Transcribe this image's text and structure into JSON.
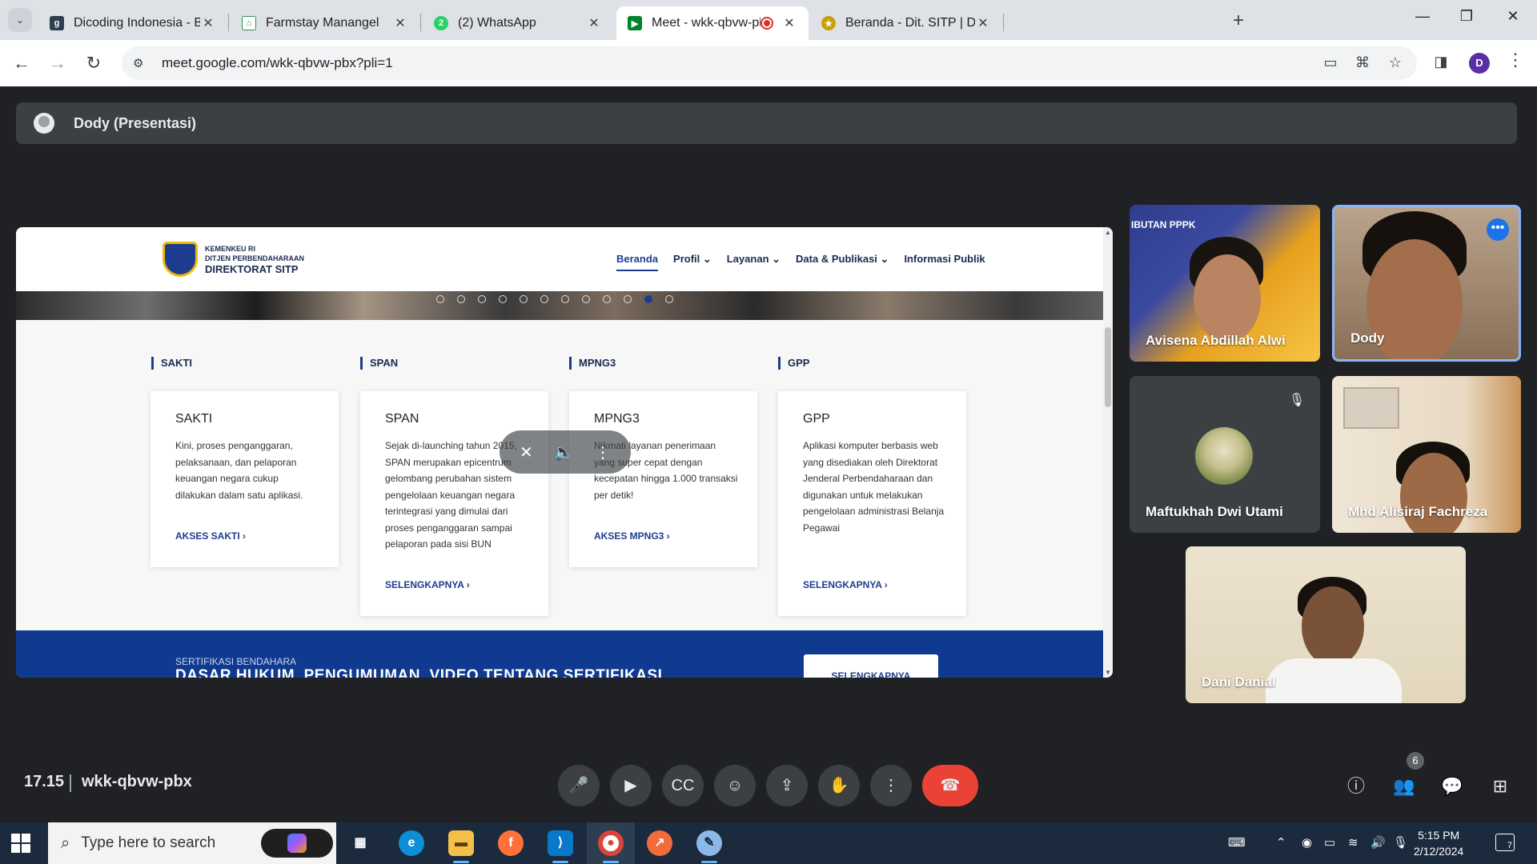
{
  "browser": {
    "tabs": [
      {
        "title": "Dicoding Indonesia - Bangun K",
        "favicon": "dicoding-favicon",
        "active": false
      },
      {
        "title": "Farmstay Manangel",
        "favicon": "farmstay-favicon",
        "active": false
      },
      {
        "title": "(2) WhatsApp",
        "favicon": "whatsapp-favicon",
        "active": false
      },
      {
        "title": "Meet - wkk-qbvw-pbx",
        "favicon": "meet-favicon",
        "active": true
      },
      {
        "title": "Beranda - Dit. SITP | DJPb Keme",
        "favicon": "kemenkeu-favicon",
        "active": false
      }
    ],
    "url": "meet.google.com/wkk-qbvw-pbx?pli=1",
    "profile_initial": "D"
  },
  "presentation": {
    "presenter_label": "Dody (Presentasi)"
  },
  "shared_site": {
    "logo_small_1": "KEMENKEU RI",
    "logo_small_2": "DITJEN PERBENDAHARAAN",
    "logo_big": "DIREKTORAT SITP",
    "nav": [
      "Beranda",
      "Profil",
      "Layanan",
      "Data & Publikasi",
      "Informasi Publik"
    ],
    "sections": [
      "SAKTI",
      "SPAN",
      "MPNG3",
      "GPP"
    ],
    "cards": [
      {
        "title": "SAKTI",
        "text": "Kini, proses penganggaran, pelaksanaan, dan pelaporan keuangan negara cukup dilakukan dalam satu aplikasi.",
        "link": "AKSES SAKTI ›"
      },
      {
        "title": "SPAN",
        "text": "Sejak di-launching tahun 2015, SPAN merupakan epicentrum gelombang perubahan sistem pengelolaan keuangan negara terintegrasi yang dimulai dari proses penganggaran sampai pelaporan pada sisi BUN",
        "link": "SELENGKAPNYA ›"
      },
      {
        "title": "MPNG3",
        "text": "Nikmati layanan penerimaan yang super cepat dengan kecepatan hingga 1.000 transaksi per detik!",
        "link": "AKSES MPNG3 ›"
      },
      {
        "title": "GPP",
        "text": "Aplikasi komputer berbasis web yang disediakan oleh Direktorat Jenderal Perbendaharaan dan digunakan untuk melakukan pengelolaan administrasi Belanja Pegawai",
        "link": "SELENGKAPNYA ›"
      }
    ],
    "footer_small": "SERTIFIKASI BENDAHARA",
    "footer_big": "DASAR HUKUM, PENGUMUMAN, VIDEO TENTANG SERTIFIKASI",
    "footer_button": "SELENGKAPNYA"
  },
  "participants": [
    {
      "name": "Avisena Abdillah Alwi",
      "bg_text": "IBUTAN PPPK"
    },
    {
      "name": "Dody",
      "speaking": true
    },
    {
      "name": "Maftukhah Dwi Utami",
      "muted": true
    },
    {
      "name": "Mhd Alisiraj Fachreza"
    },
    {
      "name": "Dani Danial"
    }
  ],
  "meeting": {
    "time": "17.15",
    "code": "wkk-qbvw-pbx",
    "participant_count": "6",
    "colors": {
      "end_call": "#ea4335",
      "control_bg": "#3c4043",
      "speaking_border": "#8ab4f8"
    }
  },
  "taskbar": {
    "search_placeholder": "Type here to search",
    "time": "5:15 PM",
    "date": "2/12/2024",
    "notification_count": "7"
  }
}
